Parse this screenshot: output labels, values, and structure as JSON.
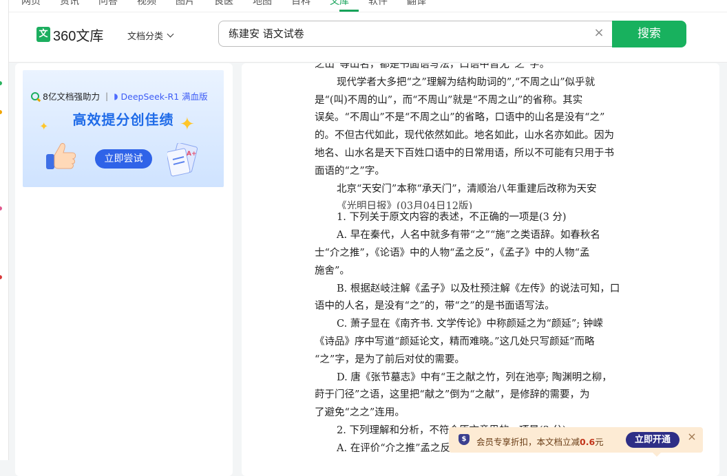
{
  "topnav": {
    "items": [
      "网页",
      "资讯",
      "问答",
      "视频",
      "图片",
      "良医",
      "地图",
      "百科",
      "文库",
      "软件",
      "翻译"
    ],
    "active": "文库"
  },
  "header": {
    "logo_text": "360文库",
    "logo_mark": "文",
    "category_label": "文档分类",
    "search_value": "练建安 语文试卷",
    "clear_glyph": "×",
    "search_button": "搜索"
  },
  "banner": {
    "top_left": "8亿文档强助力",
    "top_right": "DeepSeek-R1 满血版",
    "title": "高效提分创佳绩",
    "button": "立即尝试"
  },
  "document": {
    "lines": [
      {
        "text": "之山”等山名，都是书面语写法，口语中皆无“之”字。",
        "indent": false
      },
      {
        "text": "现代学者大多把“之”理解为结构助词的”,“不周之山”似乎就",
        "indent": true
      },
      {
        "text": "是“(叫)不周的山”，而“不周山”就是“不周之山”的省称。其实",
        "indent": false
      },
      {
        "text": "误矣。“不周山”不是“不周之山”的省略，口语中的山名是没有“之”",
        "indent": false
      },
      {
        "text": "的。不但古代如此，现代依然如此。地名如此，山水名亦如此。因为",
        "indent": false
      },
      {
        "text": "地名、山水名是天下百姓口语中的日常用语，所以不可能有只用于书",
        "indent": false
      },
      {
        "text": "面语的“之”字。",
        "indent": false
      },
      {
        "text": "北京“天安门”本称“承天门”，清顺治八年重建后改称为天安",
        "indent": true
      },
      {
        "text": "《光明日报》(03月04日12版)",
        "indent": true,
        "clip": true
      },
      {
        "text": "1. 下列关于原文内容的表述，不正确的一项是(3 分)",
        "indent": true
      },
      {
        "text": "A. 早在秦代，人名中就多有带“之”“施”之类语辞。如春秋名",
        "indent": true
      },
      {
        "text": "士“介之推”，《论语》中的人物“孟之反”，《孟子》中的人物“孟",
        "indent": false
      },
      {
        "text": "施舍”。",
        "indent": false
      },
      {
        "text": "B. 根据赵岐注解《孟子》以及杜预注解《左传》的说法可知，口",
        "indent": true
      },
      {
        "text": "语中的人名，是没有“之”的，带“之”的是书面语写法。",
        "indent": false
      },
      {
        "text": "C. 萧子显在《南齐书. 文学传论》中称颜延之为“颜延”; 钟嵘",
        "indent": true
      },
      {
        "text": "《诗品》序中写道“颜延论文，精而难晓。”这几处只写颜延”而略",
        "indent": false
      },
      {
        "text": "“之”字，是为了前后对仗的需要。",
        "indent": false
      },
      {
        "text": "D. 唐《张节墓志》中有“王之献之竹，列在池亭; 陶渊明之柳，",
        "indent": true
      },
      {
        "text": "莳于门径”之语，这里把“献之”倒为“之献”，是修辞的需要，为",
        "indent": false
      },
      {
        "text": "了避免“之之”连用。",
        "indent": false
      },
      {
        "text": "2. 下列理解和分析，不符合原文意思的一项是(3 分)",
        "indent": true
      },
      {
        "text": "A. 在评价“介之推”孟之反“孟施舍”等人名时，作者认为",
        "indent": true
      }
    ]
  },
  "promo": {
    "text_before": "会员专享折扣，本文档立减",
    "amount": "0.6",
    "text_after": "元",
    "button": "立即开通",
    "close_glyph": "×"
  },
  "colors": {
    "brand_green": "#18b15e",
    "banner_blue": "#2f63e8",
    "promo_bg": "#fdebd4",
    "promo_button": "#2e2e86"
  }
}
